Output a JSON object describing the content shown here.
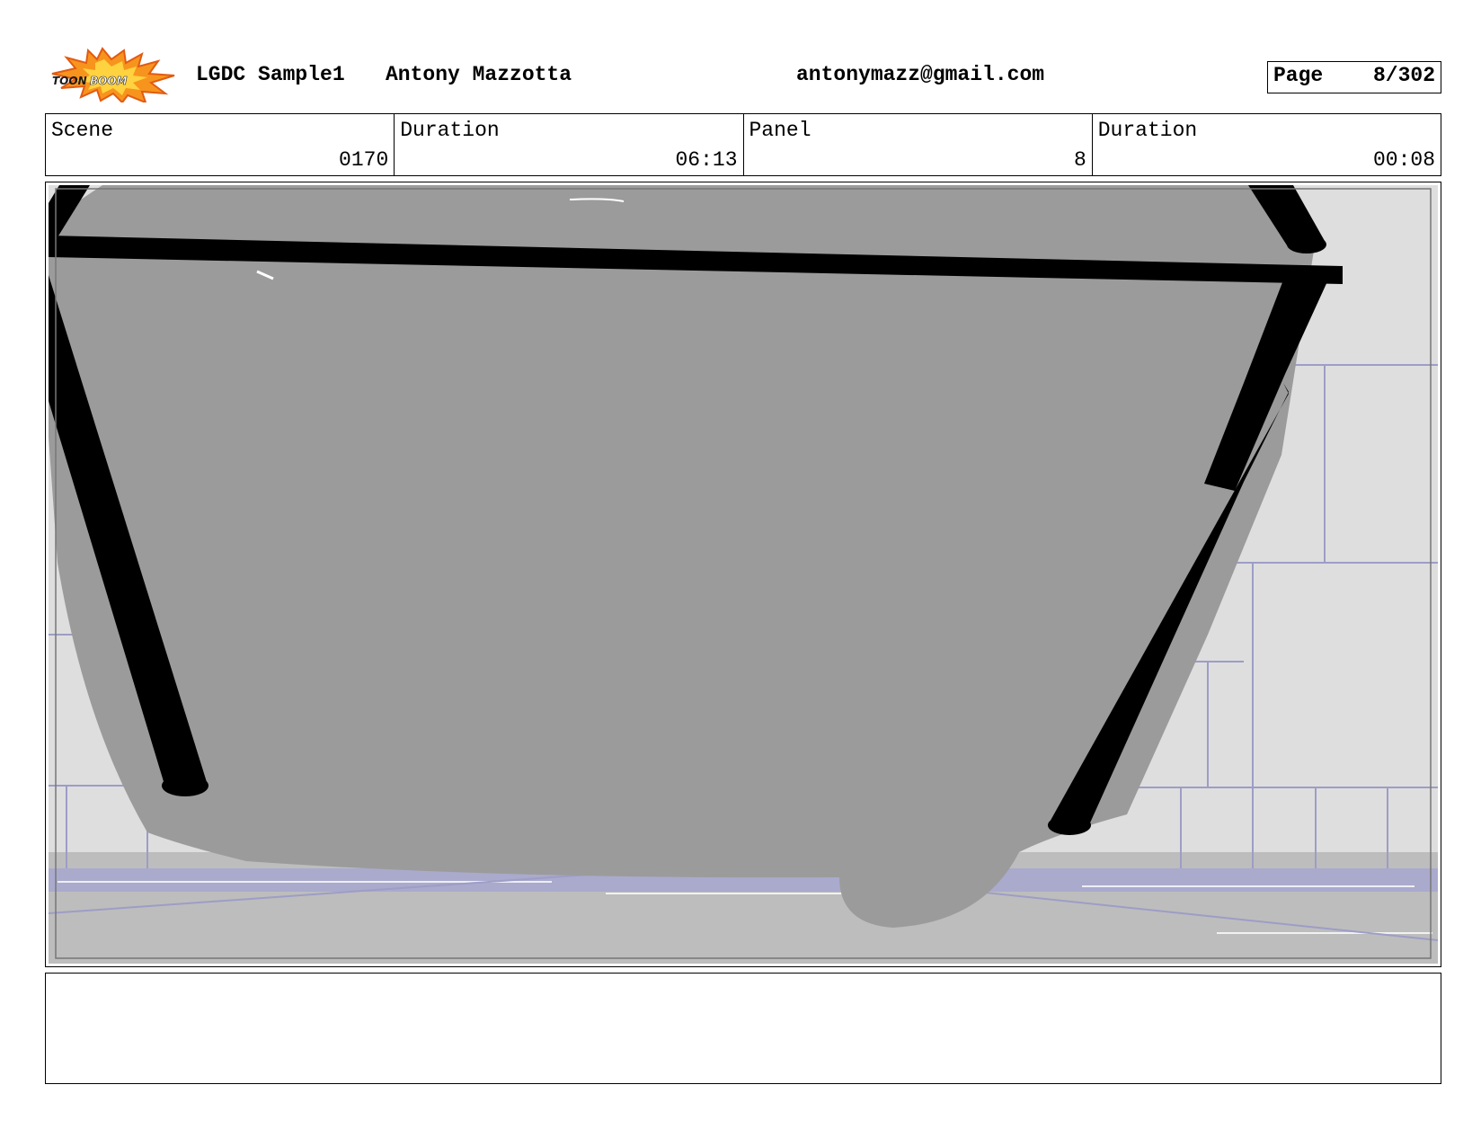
{
  "header": {
    "logo_text": "TOON BOOM",
    "project": "LGDC Sample1",
    "author": "Antony Mazzotta",
    "email": "antonymazz@gmail.com",
    "page_label": "Page",
    "page_value": "8/302"
  },
  "info": {
    "scene_label": "Scene",
    "scene_value": "0170",
    "scene_duration_label": "Duration",
    "scene_duration_value": "06:13",
    "panel_label": "Panel",
    "panel_value": "8",
    "panel_duration_label": "Duration",
    "panel_duration_value": "00:08"
  },
  "notes": {
    "text": ""
  },
  "colors": {
    "object_gray": "#9b9b9b",
    "wall_light": "#dedede",
    "floor_gray": "#bdbdbd",
    "wall_lines": "#9d9dc7",
    "outline": "#000000"
  }
}
